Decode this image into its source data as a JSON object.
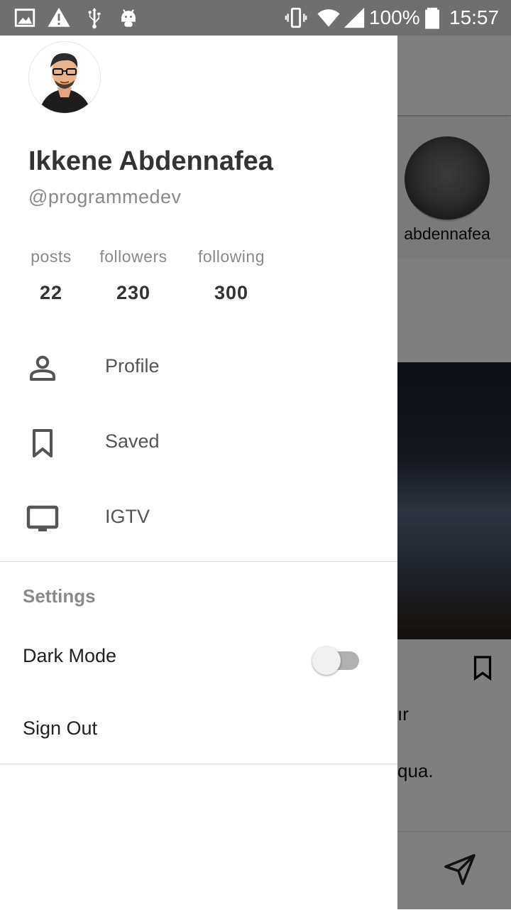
{
  "status_bar": {
    "battery": "100%",
    "time": "15:57",
    "icons": [
      "image-icon",
      "warning-icon",
      "usb-icon",
      "android-icon",
      "vibrate-icon",
      "wifi-icon",
      "signal-icon",
      "battery-icon"
    ]
  },
  "background": {
    "story_name": "abdennafea",
    "caption_line_1": "ır",
    "caption_line_2": "qua."
  },
  "drawer": {
    "name": "Ikkene Abdennafea",
    "handle": "@programmedev",
    "stats": [
      {
        "label": "posts",
        "value": "22"
      },
      {
        "label": "followers",
        "value": "230"
      },
      {
        "label": "following",
        "value": "300"
      }
    ],
    "menu": [
      {
        "label": "Profile",
        "icon": "person-icon"
      },
      {
        "label": "Saved",
        "icon": "bookmark-icon"
      },
      {
        "label": "IGTV",
        "icon": "tv-icon"
      }
    ],
    "settings_title": "Settings",
    "dark_mode_label": "Dark Mode",
    "dark_mode_on": false,
    "sign_out_label": "Sign Out"
  },
  "colors": {
    "scrim": "#000000",
    "status_bar": "#6f6f6f",
    "text_primary": "#333333",
    "text_secondary": "#8a8a8a"
  }
}
